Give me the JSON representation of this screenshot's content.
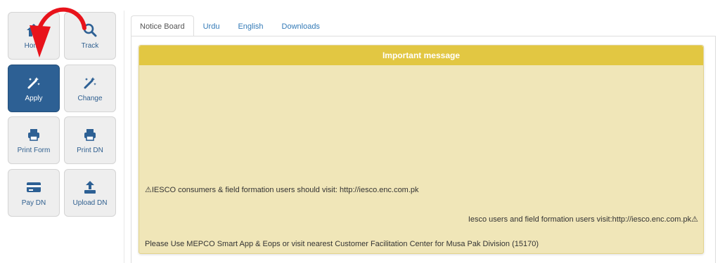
{
  "tiles": {
    "home": {
      "label": "Home",
      "icon": "home-icon"
    },
    "track": {
      "label": "Track",
      "icon": "search-icon"
    },
    "apply": {
      "label": "Apply",
      "icon": "magic-wand-icon",
      "active": true
    },
    "change": {
      "label": "Change",
      "icon": "magic-wand-icon"
    },
    "print_form": {
      "label": "Print Form",
      "icon": "printer-icon"
    },
    "print_dn": {
      "label": "Print DN",
      "icon": "printer-icon"
    },
    "pay_dn": {
      "label": "Pay DN",
      "icon": "credit-card-icon"
    },
    "upload_dn": {
      "label": "Upload DN",
      "icon": "upload-icon"
    }
  },
  "tabs": [
    {
      "label": "Notice Board",
      "active": true
    },
    {
      "label": "Urdu"
    },
    {
      "label": "English"
    },
    {
      "label": "Downloads"
    }
  ],
  "notice": {
    "title": "Important message",
    "lines": [
      "⚠IESCO consumers & field formation users should visit: http://iesco.enc.com.pk",
      "Iesco users and field formation users visit:http://iesco.enc.com.pk⚠",
      "Please Use MEPCO Smart App & Eops or visit nearest Customer Facilitation Center for Musa Pak Division (15170)"
    ]
  },
  "colors": {
    "accent": "#2d6094",
    "panel_header": "#e2c742",
    "panel_body": "#f0e6b8",
    "annotation_arrow": "#e8131b"
  }
}
